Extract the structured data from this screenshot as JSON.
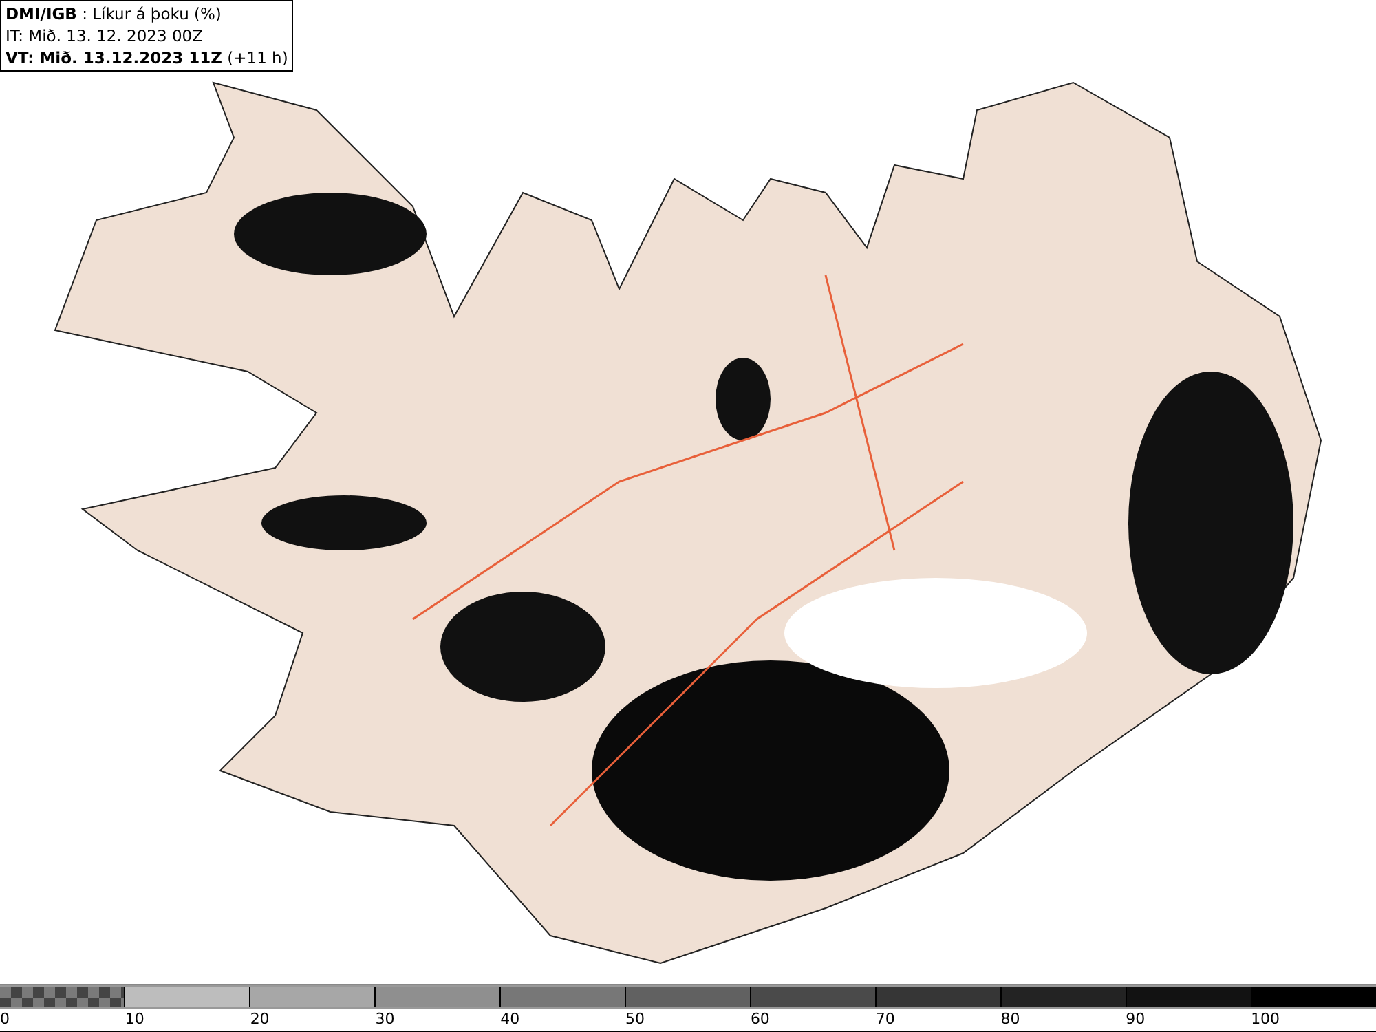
{
  "header": {
    "lines": [
      "**DMI/IGB** : Líkur á þoku (%)",
      "IT: Mið. 13. 12. 2023 00Z",
      "**VT: Mið. 13.12.2023 11Z** (+11 h)"
    ]
  },
  "legend": {
    "segments": [
      {
        "kind": "checker",
        "color": "#7a7a7a",
        "label": "0"
      },
      {
        "kind": "solid",
        "color": "#bdbdbd",
        "label": "10"
      },
      {
        "kind": "solid",
        "color": "#a7a7a7",
        "label": "20"
      },
      {
        "kind": "solid",
        "color": "#8f8f8f",
        "label": "30"
      },
      {
        "kind": "solid",
        "color": "#777777",
        "label": "40"
      },
      {
        "kind": "solid",
        "color": "#616161",
        "label": "50"
      },
      {
        "kind": "solid",
        "color": "#4a4a4a",
        "label": "60"
      },
      {
        "kind": "solid",
        "color": "#363636",
        "label": "70"
      },
      {
        "kind": "solid",
        "color": "#232323",
        "label": "80"
      },
      {
        "kind": "solid",
        "color": "#121212",
        "label": "90"
      },
      {
        "kind": "solid",
        "color": "#000000",
        "label": "100"
      }
    ]
  }
}
